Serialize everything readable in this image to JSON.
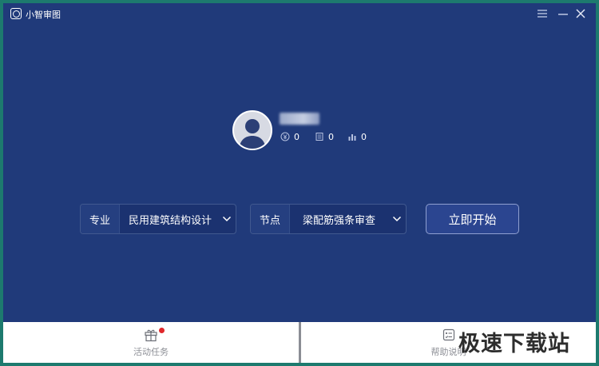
{
  "app": {
    "title": "小智审图"
  },
  "user": {
    "coins": "0",
    "docs": "0",
    "stats": "0"
  },
  "selectors": {
    "major": {
      "label": "专业",
      "value": "民用建筑结构设计"
    },
    "node": {
      "label": "节点",
      "value": "梁配筋强条审查"
    }
  },
  "start_button": {
    "label": "立即开始"
  },
  "bottom": {
    "task_label": "活动任务",
    "help_label": "帮助说明"
  },
  "watermark": "极速下载站",
  "colors": {
    "window_bg": "#203a7a",
    "accent_dot": "#e0272b",
    "bottom_text": "#8d8f96"
  }
}
